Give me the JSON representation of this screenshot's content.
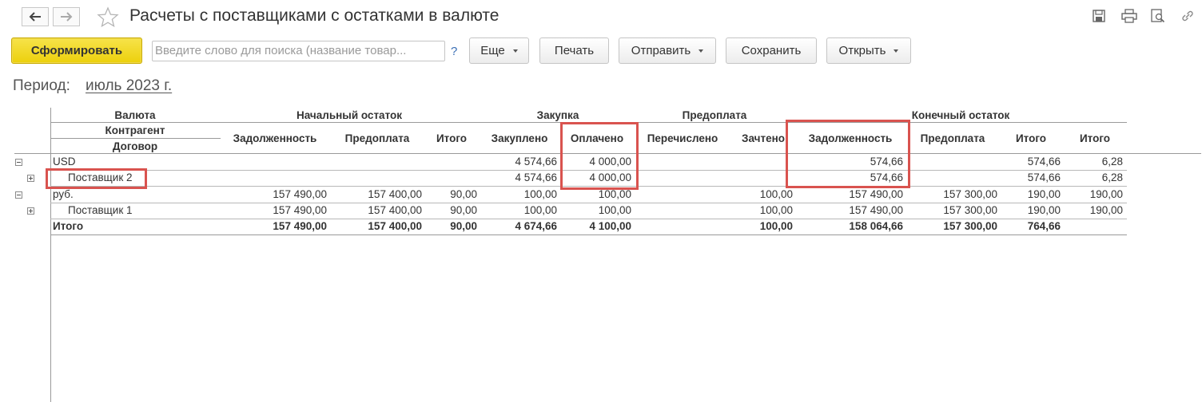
{
  "window": {
    "title": "Расчеты с поставщиками с остатками в валюте"
  },
  "toolbar": {
    "generate_label": "Сформировать",
    "search_placeholder": "Введите слово для поиска (название товар...",
    "help_label": "?",
    "more_label": "Еще",
    "print_label": "Печать",
    "send_label": "Отправить",
    "save_label": "Сохранить",
    "open_label": "Открыть"
  },
  "period": {
    "label": "Период:",
    "value": "июль 2023 г."
  },
  "table": {
    "headers": {
      "currency": "Валюта",
      "counterparty": "Контрагент",
      "contract": "Договор",
      "opening": "Начальный остаток",
      "purchase": "Закупка",
      "prepayment": "Предоплата",
      "closing": "Конечный остаток",
      "cols": [
        "Задолженность",
        "Предоплата",
        "Итого",
        "Закуплено",
        "Оплачено",
        "Перечислено",
        "Зачтено",
        "Задолженность",
        "Предоплата",
        "Итого",
        "Итого"
      ]
    },
    "rows": [
      {
        "label": "USD",
        "values": [
          "",
          "",
          "",
          "4 574,66",
          "4 000,00",
          "",
          "",
          "574,66",
          "",
          "574,66",
          "6,28"
        ]
      },
      {
        "label": "Поставщик 2",
        "values": [
          "",
          "",
          "",
          "4 574,66",
          "4 000,00",
          "",
          "",
          "574,66",
          "",
          "574,66",
          "6,28"
        ]
      },
      {
        "label": "руб.",
        "values": [
          "157 490,00",
          "157 400,00",
          "90,00",
          "100,00",
          "100,00",
          "",
          "100,00",
          "157 490,00",
          "157 300,00",
          "190,00",
          "190,00"
        ]
      },
      {
        "label": "Поставщик 1",
        "values": [
          "157 490,00",
          "157 400,00",
          "90,00",
          "100,00",
          "100,00",
          "",
          "100,00",
          "157 490,00",
          "157 300,00",
          "190,00",
          "190,00"
        ]
      }
    ],
    "total": {
      "label": "Итого",
      "values": [
        "157 490,00",
        "157 400,00",
        "90,00",
        "4 674,66",
        "4 100,00",
        "",
        "100,00",
        "158 064,66",
        "157 300,00",
        "764,66",
        ""
      ]
    }
  }
}
